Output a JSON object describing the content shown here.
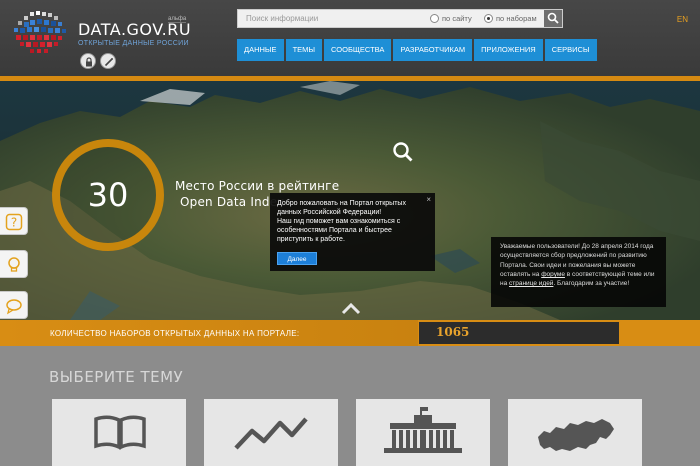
{
  "header": {
    "site_name": "DATA.GOV.RU",
    "beta": "альфа",
    "tagline": "ОТКРЫТЫЕ ДАННЫЕ РОССИИ",
    "search": {
      "placeholder": "Поиск информации",
      "option_site": "по сайту",
      "option_sets": "по наборам",
      "selected": "по наборам"
    },
    "lang": "EN",
    "nav": [
      "ДАННЫЕ",
      "ТЕМЫ",
      "СООБЩЕСТВА",
      "РАЗРАБОТЧИКАМ",
      "ПРИЛОЖЕНИЯ",
      "СЕРВИСЫ"
    ]
  },
  "hero": {
    "rank": "30",
    "rank_title": "Место России в рейтинге",
    "rank_subtitle": "Open Data Index",
    "popup": {
      "text": "Добро пожаловать на Портал открытых данных Российской Федерации!\nНаш гид поможет вам ознакомиться с особенностями Портала и быстрее приступить к работе.",
      "button": "Далее",
      "close": "×"
    },
    "notice": {
      "text_1": "Уважаемые пользователи! До 28 апреля 2014 года осуществляется сбор предложений по развитию Портала. Свои идеи и пожелания вы можете оставлять на ",
      "link_1": "форуме",
      "text_2": " в соответствующей теме или на ",
      "link_2": "странице идей",
      "text_3": ". Благодарим за участие!"
    }
  },
  "counter": {
    "label": "КОЛИЧЕСТВО НАБОРОВ ОТКРЫТЫХ ДАННЫХ НА ПОРТАЛЕ:",
    "value": "1065"
  },
  "topics": {
    "title": "ВЫБЕРИТЕ ТЕМУ",
    "tiles": [
      "book-icon",
      "line-chart-icon",
      "government-building-icon",
      "russia-map-icon"
    ]
  },
  "colors": {
    "accent": "#d88d14",
    "nav_blue": "#1e8fd6",
    "header": "#3f3f3f"
  }
}
